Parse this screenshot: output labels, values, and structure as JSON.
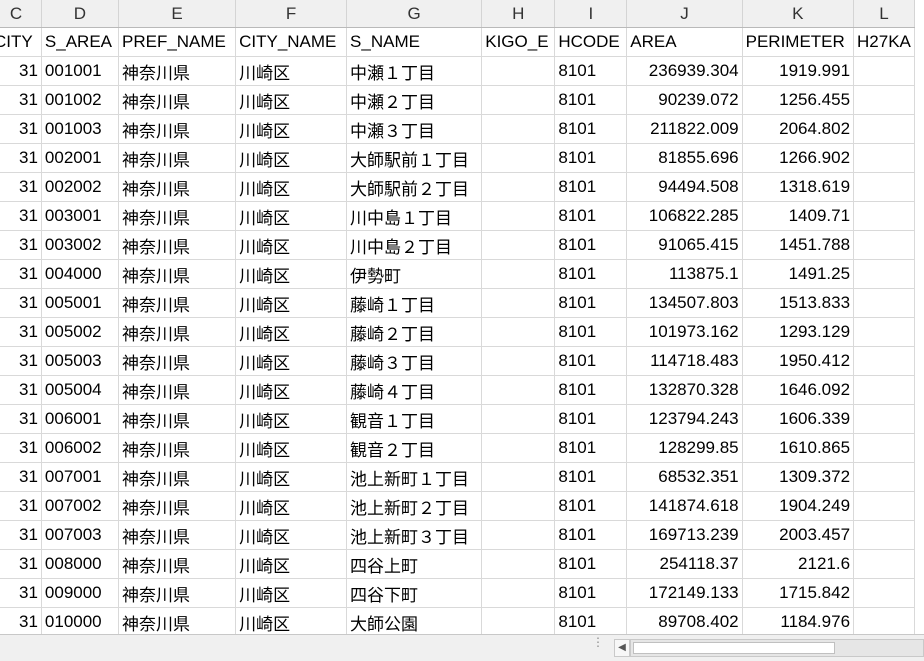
{
  "columns": [
    "C",
    "D",
    "E",
    "F",
    "G",
    "H",
    "I",
    "J",
    "K",
    "L"
  ],
  "fields": [
    "CITY",
    "S_AREA",
    "PREF_NAME",
    "CITY_NAME",
    "S_NAME",
    "KIGO_E",
    "HCODE",
    "AREA",
    "PERIMETER",
    "H27KA"
  ],
  "rows": [
    {
      "city": "31",
      "s_area": "001001",
      "pref": "神奈川県",
      "city_name": "川崎区",
      "s_name": "中瀬１丁目",
      "kigo": "",
      "hcode": "8101",
      "area": "236939.304",
      "perimeter": "1919.991"
    },
    {
      "city": "31",
      "s_area": "001002",
      "pref": "神奈川県",
      "city_name": "川崎区",
      "s_name": "中瀬２丁目",
      "kigo": "",
      "hcode": "8101",
      "area": "90239.072",
      "perimeter": "1256.455"
    },
    {
      "city": "31",
      "s_area": "001003",
      "pref": "神奈川県",
      "city_name": "川崎区",
      "s_name": "中瀬３丁目",
      "kigo": "",
      "hcode": "8101",
      "area": "211822.009",
      "perimeter": "2064.802"
    },
    {
      "city": "31",
      "s_area": "002001",
      "pref": "神奈川県",
      "city_name": "川崎区",
      "s_name": "大師駅前１丁目",
      "kigo": "",
      "hcode": "8101",
      "area": "81855.696",
      "perimeter": "1266.902"
    },
    {
      "city": "31",
      "s_area": "002002",
      "pref": "神奈川県",
      "city_name": "川崎区",
      "s_name": "大師駅前２丁目",
      "kigo": "",
      "hcode": "8101",
      "area": "94494.508",
      "perimeter": "1318.619"
    },
    {
      "city": "31",
      "s_area": "003001",
      "pref": "神奈川県",
      "city_name": "川崎区",
      "s_name": "川中島１丁目",
      "kigo": "",
      "hcode": "8101",
      "area": "106822.285",
      "perimeter": "1409.71"
    },
    {
      "city": "31",
      "s_area": "003002",
      "pref": "神奈川県",
      "city_name": "川崎区",
      "s_name": "川中島２丁目",
      "kigo": "",
      "hcode": "8101",
      "area": "91065.415",
      "perimeter": "1451.788"
    },
    {
      "city": "31",
      "s_area": "004000",
      "pref": "神奈川県",
      "city_name": "川崎区",
      "s_name": "伊勢町",
      "kigo": "",
      "hcode": "8101",
      "area": "113875.1",
      "perimeter": "1491.25"
    },
    {
      "city": "31",
      "s_area": "005001",
      "pref": "神奈川県",
      "city_name": "川崎区",
      "s_name": "藤崎１丁目",
      "kigo": "",
      "hcode": "8101",
      "area": "134507.803",
      "perimeter": "1513.833"
    },
    {
      "city": "31",
      "s_area": "005002",
      "pref": "神奈川県",
      "city_name": "川崎区",
      "s_name": "藤崎２丁目",
      "kigo": "",
      "hcode": "8101",
      "area": "101973.162",
      "perimeter": "1293.129"
    },
    {
      "city": "31",
      "s_area": "005003",
      "pref": "神奈川県",
      "city_name": "川崎区",
      "s_name": "藤崎３丁目",
      "kigo": "",
      "hcode": "8101",
      "area": "114718.483",
      "perimeter": "1950.412"
    },
    {
      "city": "31",
      "s_area": "005004",
      "pref": "神奈川県",
      "city_name": "川崎区",
      "s_name": "藤崎４丁目",
      "kigo": "",
      "hcode": "8101",
      "area": "132870.328",
      "perimeter": "1646.092"
    },
    {
      "city": "31",
      "s_area": "006001",
      "pref": "神奈川県",
      "city_name": "川崎区",
      "s_name": "観音１丁目",
      "kigo": "",
      "hcode": "8101",
      "area": "123794.243",
      "perimeter": "1606.339"
    },
    {
      "city": "31",
      "s_area": "006002",
      "pref": "神奈川県",
      "city_name": "川崎区",
      "s_name": "観音２丁目",
      "kigo": "",
      "hcode": "8101",
      "area": "128299.85",
      "perimeter": "1610.865"
    },
    {
      "city": "31",
      "s_area": "007001",
      "pref": "神奈川県",
      "city_name": "川崎区",
      "s_name": "池上新町１丁目",
      "kigo": "",
      "hcode": "8101",
      "area": "68532.351",
      "perimeter": "1309.372"
    },
    {
      "city": "31",
      "s_area": "007002",
      "pref": "神奈川県",
      "city_name": "川崎区",
      "s_name": "池上新町２丁目",
      "kigo": "",
      "hcode": "8101",
      "area": "141874.618",
      "perimeter": "1904.249"
    },
    {
      "city": "31",
      "s_area": "007003",
      "pref": "神奈川県",
      "city_name": "川崎区",
      "s_name": "池上新町３丁目",
      "kigo": "",
      "hcode": "8101",
      "area": "169713.239",
      "perimeter": "2003.457"
    },
    {
      "city": "31",
      "s_area": "008000",
      "pref": "神奈川県",
      "city_name": "川崎区",
      "s_name": "四谷上町",
      "kigo": "",
      "hcode": "8101",
      "area": "254118.37",
      "perimeter": "2121.6"
    },
    {
      "city": "31",
      "s_area": "009000",
      "pref": "神奈川県",
      "city_name": "川崎区",
      "s_name": "四谷下町",
      "kigo": "",
      "hcode": "8101",
      "area": "172149.133",
      "perimeter": "1715.842"
    },
    {
      "city": "31",
      "s_area": "010000",
      "pref": "神奈川県",
      "city_name": "川崎区",
      "s_name": "大師公園",
      "kigo": "",
      "hcode": "8101",
      "area": "89708.402",
      "perimeter": "1184.976"
    }
  ],
  "scrollbar": {
    "left_arrow": "◀",
    "splitter": "⋮"
  }
}
